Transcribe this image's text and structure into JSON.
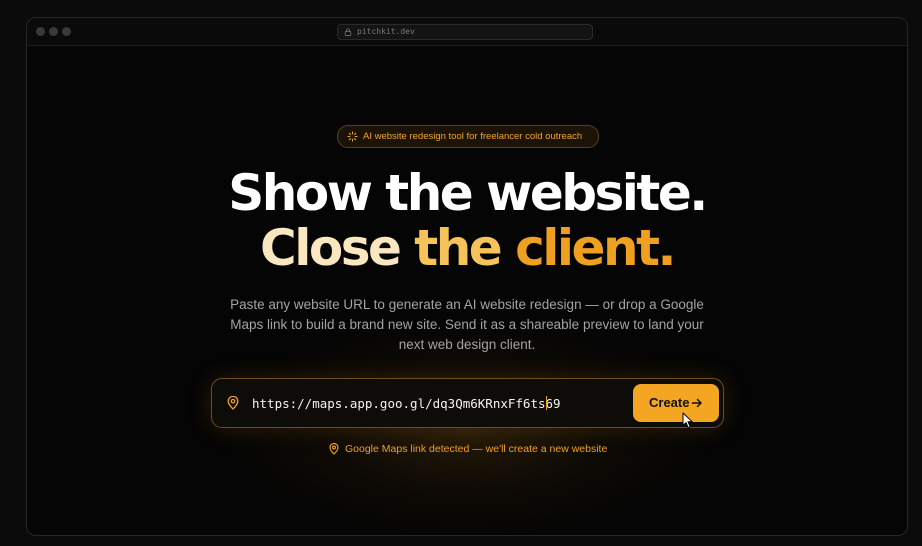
{
  "window": {
    "url": "pitchkit.dev"
  },
  "badge": {
    "text": "AI website redesign tool for freelancer cold outreach",
    "icon": "sparkle-icon"
  },
  "hero": {
    "line1": "Show the website.",
    "line2": {
      "word1": "Close",
      "word2": "the",
      "word3": "client."
    },
    "description": "Paste any website URL to generate an AI website redesign — or drop a Google Maps link to build a brand new site. Send it as a shareable preview to land your next web design client."
  },
  "form": {
    "url_value": "https://maps.app.goo.gl/dq3Qm6KRnxFf6ts69",
    "input_icon": "map-pin-icon",
    "button_label": "Create",
    "button_icon": "arrow-right-icon",
    "hint": "Google Maps link detected — we'll create a new website",
    "hint_icon": "map-pin-icon"
  },
  "colors": {
    "accent": "#f4a522",
    "background": "#050505",
    "heading": "#ffffff",
    "body_text": "#a3a3a3"
  }
}
